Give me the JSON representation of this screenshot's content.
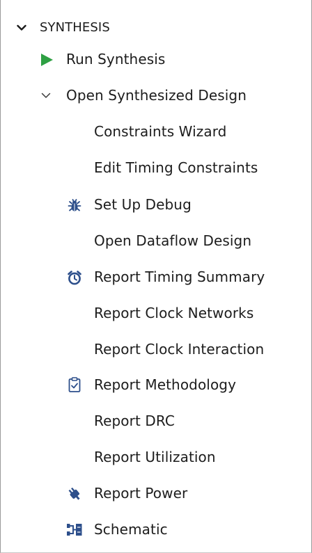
{
  "section": {
    "label": "SYNTHESIS",
    "icon": "chevron-down-icon",
    "expanded": true
  },
  "items": {
    "run_synthesis": {
      "label": "Run Synthesis",
      "icon": "play-icon",
      "color": "#2ea043"
    },
    "open_synth_design": {
      "label": "Open Synthesized Design",
      "icon": "chevron-down-icon",
      "expanded": true
    },
    "constraints_wizard": {
      "label": "Constraints Wizard"
    },
    "edit_timing_constraints": {
      "label": "Edit Timing Constraints"
    },
    "set_up_debug": {
      "label": "Set Up Debug",
      "icon": "bug-icon"
    },
    "open_dataflow_design": {
      "label": "Open Dataflow Design"
    },
    "report_timing_summary": {
      "label": "Report Timing Summary",
      "icon": "alarm-clock-icon"
    },
    "report_clock_networks": {
      "label": "Report Clock Networks"
    },
    "report_clock_interaction": {
      "label": "Report Clock Interaction"
    },
    "report_methodology": {
      "label": "Report Methodology",
      "icon": "clipboard-check-icon"
    },
    "report_drc": {
      "label": "Report DRC"
    },
    "report_utilization": {
      "label": "Report Utilization"
    },
    "report_power": {
      "label": "Report Power",
      "icon": "power-plug-icon"
    },
    "schematic": {
      "label": "Schematic",
      "icon": "schematic-icon"
    }
  },
  "colors": {
    "icon_blue": "#2d4f8b",
    "run_green": "#2ea043",
    "text": "#1c1c1c"
  }
}
